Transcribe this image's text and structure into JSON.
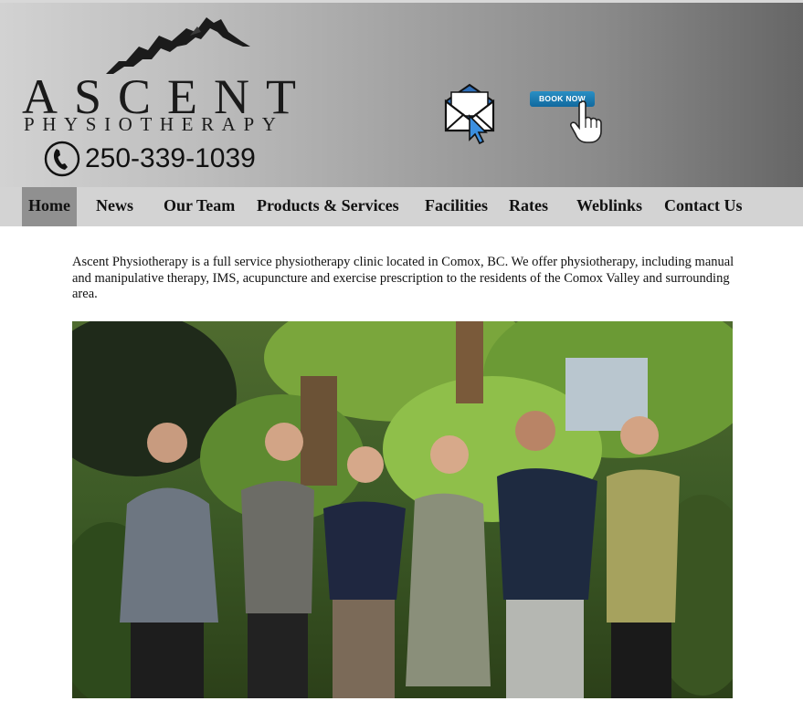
{
  "header": {
    "logo": {
      "main": "ASCENT",
      "sub": "PHYSIOTHERAPY"
    },
    "phone": {
      "number": "250-339-1039",
      "icon": "phone-icon"
    },
    "email_icon": "envelope-click-icon",
    "book_now": {
      "label": "BOOK NOW",
      "icon": "hand-cursor-icon"
    },
    "colors": {
      "gradient_start": "#d2d2d2",
      "gradient_end": "#666666",
      "book_blue": "#1a7db5"
    }
  },
  "nav": {
    "items": [
      {
        "label": "Home",
        "active": true
      },
      {
        "label": "News",
        "active": false
      },
      {
        "label": "Our Team",
        "active": false
      },
      {
        "label": "Products & Services",
        "active": false
      },
      {
        "label": "Facilities",
        "active": false
      },
      {
        "label": "Rates",
        "active": false
      },
      {
        "label": "Weblinks",
        "active": false
      },
      {
        "label": "Contact Us",
        "active": false
      }
    ],
    "colors": {
      "bar": "#d3d3d3",
      "active": "#909090"
    }
  },
  "main": {
    "intro": "Ascent Physiotherapy is a full service physiotherapy clinic located in Comox, BC.  We offer physiotherapy, including manual and manipulative therapy, IMS, acupuncture and exercise prescription to the residents of the Comox Valley and surrounding area.",
    "team_photo": {
      "people_count": 6
    }
  }
}
